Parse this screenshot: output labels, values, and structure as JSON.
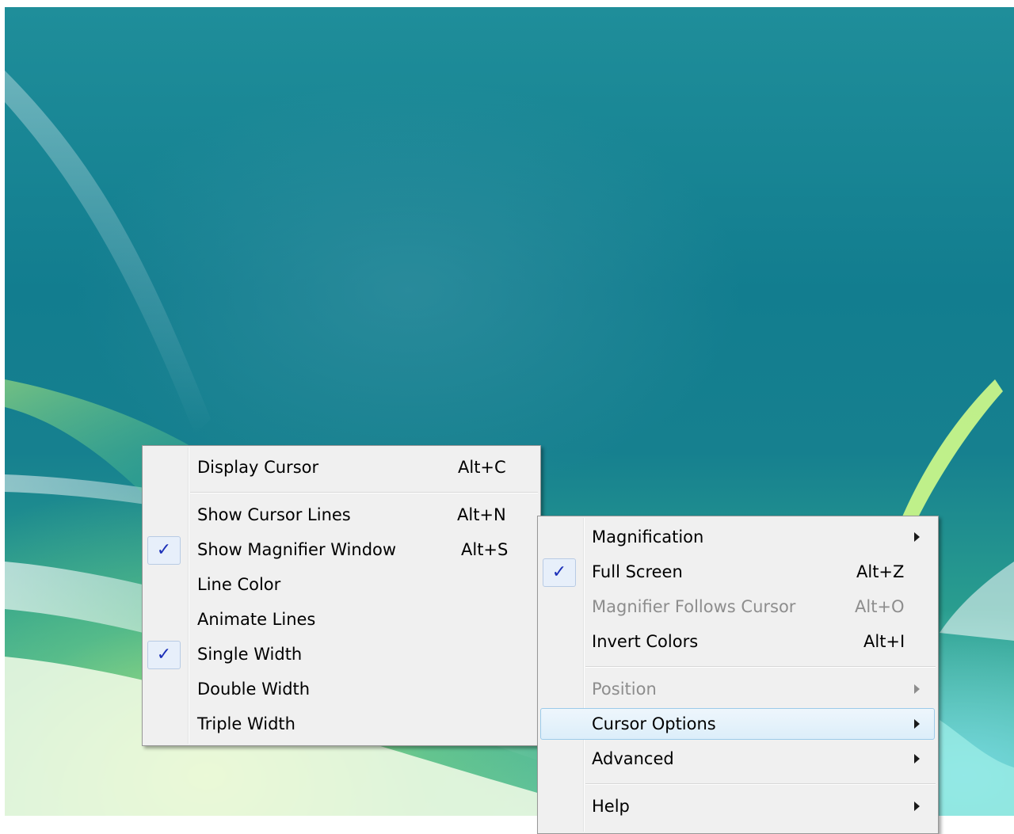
{
  "cursor_submenu": {
    "items": [
      {
        "label": "Display Cursor",
        "shortcut": "Alt+C",
        "checked": false
      },
      {
        "label": "Show Cursor Lines",
        "shortcut": "Alt+N",
        "checked": false
      },
      {
        "label": "Show Magnifier Window",
        "shortcut": "Alt+S",
        "checked": true
      },
      {
        "label": "Line Color",
        "shortcut": "",
        "checked": false
      },
      {
        "label": "Animate Lines",
        "shortcut": "",
        "checked": false
      },
      {
        "label": "Single Width",
        "shortcut": "",
        "checked": true
      },
      {
        "label": "Double Width",
        "shortcut": "",
        "checked": false
      },
      {
        "label": "Triple Width",
        "shortcut": "",
        "checked": false
      }
    ]
  },
  "main_menu": {
    "items": [
      {
        "label": "Magnification",
        "shortcut": "",
        "submenu": true,
        "checked": false,
        "disabled": false
      },
      {
        "label": "Full Screen",
        "shortcut": "Alt+Z",
        "submenu": false,
        "checked": true,
        "disabled": false
      },
      {
        "label": "Magnifier Follows Cursor",
        "shortcut": "Alt+O",
        "submenu": false,
        "checked": false,
        "disabled": true
      },
      {
        "label": "Invert Colors",
        "shortcut": "Alt+I",
        "submenu": false,
        "checked": false,
        "disabled": false
      },
      {
        "label": "Position",
        "shortcut": "",
        "submenu": true,
        "checked": false,
        "disabled": true
      },
      {
        "label": "Cursor Options",
        "shortcut": "",
        "submenu": true,
        "checked": false,
        "disabled": false,
        "highlighted": true
      },
      {
        "label": "Advanced",
        "shortcut": "",
        "submenu": true,
        "checked": false,
        "disabled": false
      },
      {
        "label": "Help",
        "shortcut": "",
        "submenu": true,
        "checked": false,
        "disabled": false
      }
    ]
  },
  "check_glyph": "✓",
  "colors": {
    "menu_bg": "#f0f0f0",
    "check_color": "#1b2fb8",
    "disabled_text": "#8d8d8d",
    "highlight_border": "#9ccbe9"
  }
}
